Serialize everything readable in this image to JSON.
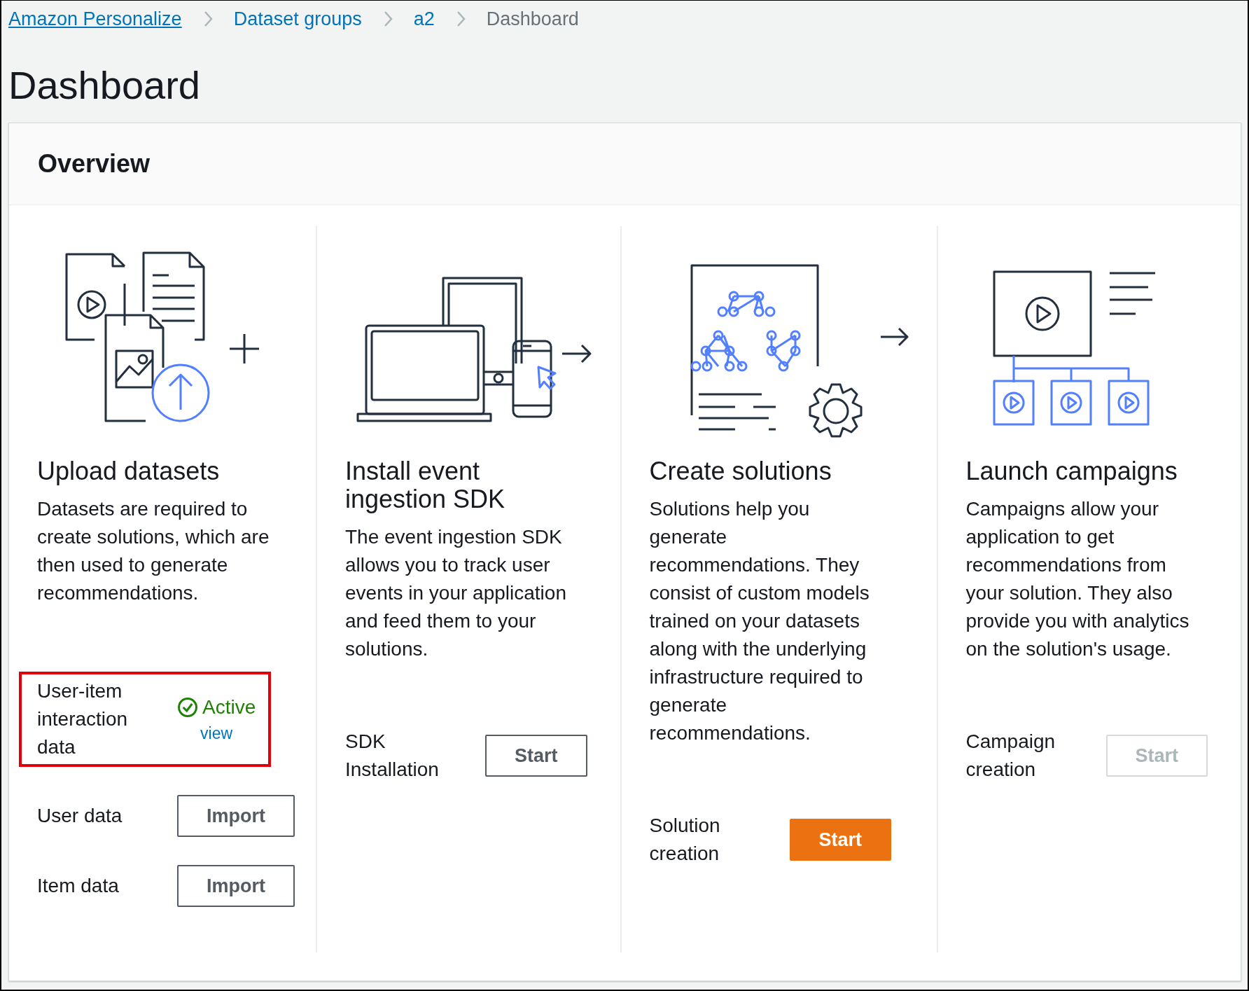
{
  "breadcrumbs": [
    {
      "label": "Amazon Personalize",
      "kind": "link",
      "focused": true
    },
    {
      "label": "Dataset groups",
      "kind": "link",
      "focused": false
    },
    {
      "label": "a2",
      "kind": "link",
      "focused": false
    },
    {
      "label": "Dashboard",
      "kind": "current",
      "focused": false
    }
  ],
  "page_title": "Dashboard",
  "overview": {
    "title": "Overview",
    "columns": [
      {
        "kind": "upload",
        "title": "Upload datasets",
        "description": "Datasets are required to create solutions, which are then used to generate recommendations.",
        "actions": [
          {
            "kind": "status",
            "label": "User-item interaction data",
            "status": "Active",
            "link": "view",
            "highlighted": true
          },
          {
            "kind": "button",
            "label": "User data",
            "button": "Import",
            "primary": false,
            "disabled": false
          },
          {
            "kind": "button",
            "label": "Item data",
            "button": "Import",
            "primary": false,
            "disabled": false
          }
        ]
      },
      {
        "kind": "sdk",
        "title": "Install event ingestion SDK",
        "description": "The event ingestion SDK allows you to track user events in your application and feed them to your solutions.",
        "actions": [
          {
            "kind": "button",
            "label": "SDK Installation",
            "button": "Start",
            "primary": false,
            "disabled": false
          }
        ]
      },
      {
        "kind": "solutions",
        "title": "Create solutions",
        "description": "Solutions help you generate recommendations. They consist of custom models trained on your datasets along with the underlying infrastructure required to generate recommendations.",
        "actions": [
          {
            "kind": "button",
            "label": "Solution creation",
            "button": "Start",
            "primary": true,
            "disabled": false
          }
        ]
      },
      {
        "kind": "campaigns",
        "title": "Launch campaigns",
        "description": "Campaigns allow your application to get recommendations from your solution. They also provide you with analytics on the solution's usage.",
        "actions": [
          {
            "kind": "button",
            "label": "Campaign creation",
            "button": "Start",
            "primary": false,
            "disabled": true
          }
        ]
      }
    ]
  }
}
